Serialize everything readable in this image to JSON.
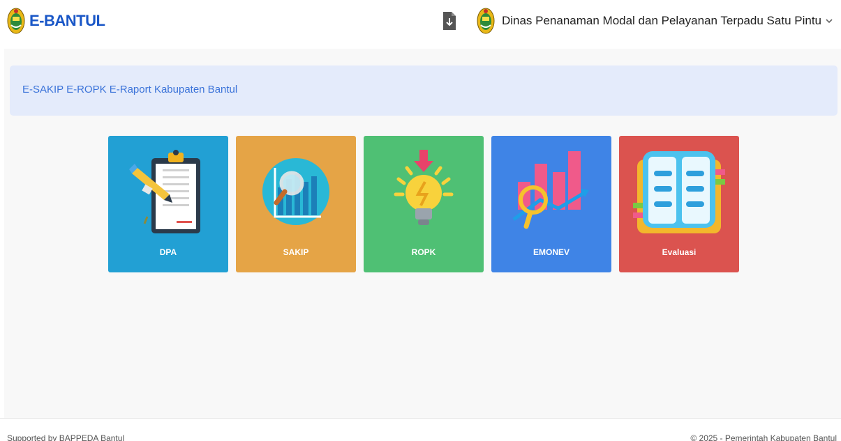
{
  "header": {
    "brand_text": "E-BANTUL",
    "user_name": "Dinas Penanaman Modal dan Pelayanan Terpadu Satu Pintu",
    "icons": {
      "logo": "bantul-crest-icon",
      "download": "file-download-icon",
      "menu": "chevron-down-icon"
    }
  },
  "banner": {
    "text": "E-SAKIP E-ROPK E-Raport Kabupaten Bantul"
  },
  "cards": [
    {
      "label": "DPA",
      "color": "#22a0d4",
      "icon": "clipboard-document-icon"
    },
    {
      "label": "SAKIP",
      "color": "#e5a446",
      "icon": "magnifier-chart-icon"
    },
    {
      "label": "ROPK",
      "color": "#4fc074",
      "icon": "lightbulb-icon"
    },
    {
      "label": "EMONEV",
      "color": "#3f84e6",
      "icon": "bar-chart-magnifier-icon"
    },
    {
      "label": "Evaluasi",
      "color": "#db534f",
      "icon": "open-book-icon"
    }
  ],
  "footer": {
    "left": "Supported by BAPPEDA Bantul",
    "right": "© 2025 - Pemerintah Kabupaten Bantul"
  },
  "colors": {
    "brand": "#1a57c7",
    "banner_bg": "#e4ebfb",
    "banner_text": "#3b73d9"
  }
}
